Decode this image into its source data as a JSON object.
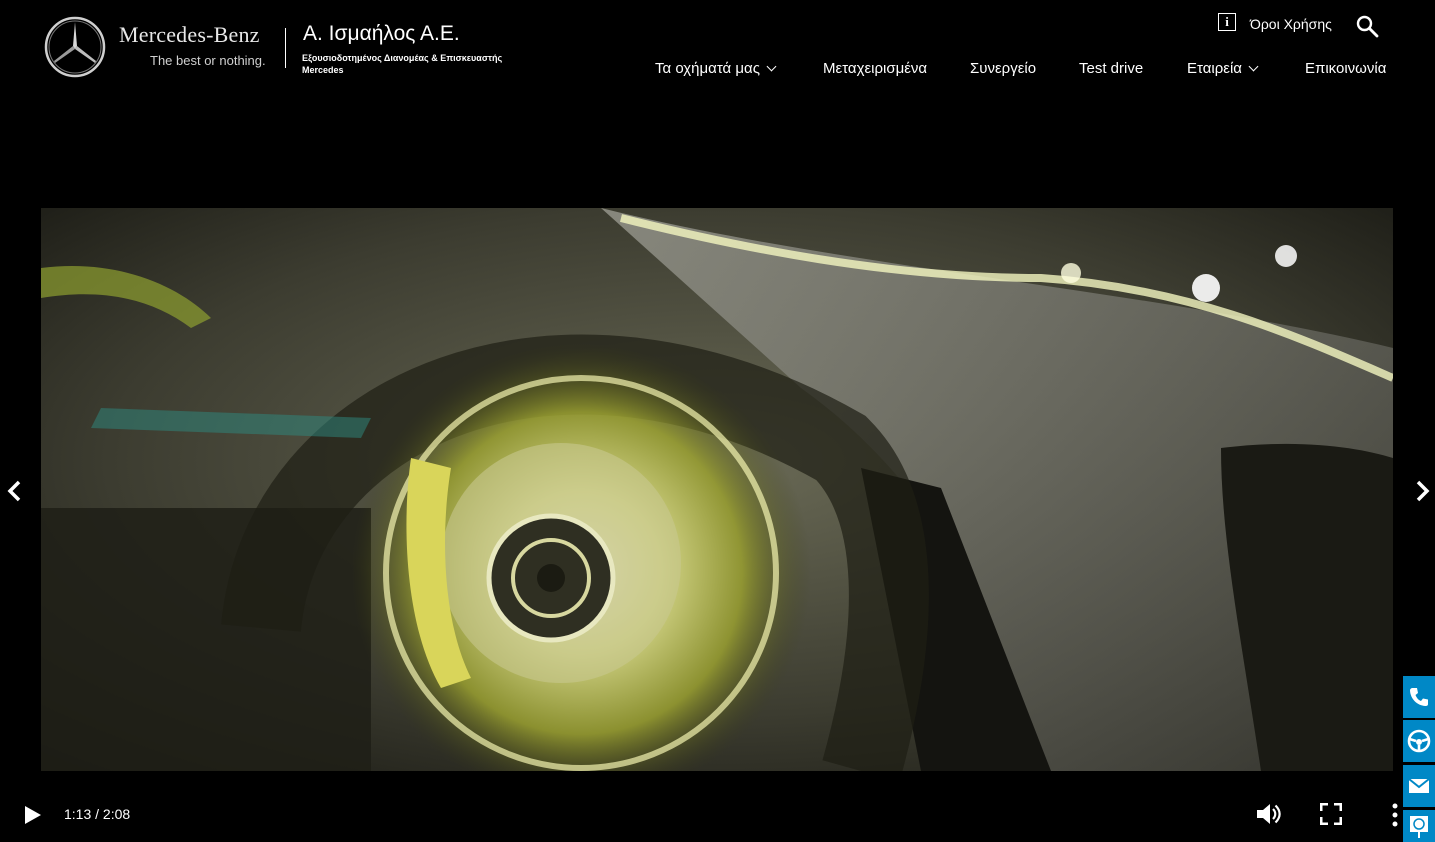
{
  "header": {
    "brand": "Mercedes-Benz",
    "tagline": "The best or nothing.",
    "dealer_name": "Α. Ισμαήλος Α.Ε.",
    "dealer_subtitle": "Εξουσιοδοτημένος Διανομέας & Επισκευαστής Mercedes",
    "terms_label": "Όροι Χρήσης",
    "info_icon": "i"
  },
  "nav": {
    "items": [
      {
        "label": "Τα οχήματά μας",
        "dropdown": true
      },
      {
        "label": "Μεταχειρισμένα",
        "dropdown": false
      },
      {
        "label": "Συνεργείο",
        "dropdown": false
      },
      {
        "label": "Test drive",
        "dropdown": false
      },
      {
        "label": "Εταιρεία",
        "dropdown": true
      },
      {
        "label": "Επικοινωνία",
        "dropdown": false
      }
    ]
  },
  "video": {
    "current_time": "1:13",
    "duration": "2:08",
    "time_display": "1:13 / 2:08",
    "playing": false
  },
  "side_buttons": [
    "phone-icon",
    "steering-wheel-icon",
    "mail-icon",
    "location-icon"
  ],
  "colors": {
    "accent": "#0088c6",
    "background": "#000000",
    "glow": "#d8e060"
  }
}
